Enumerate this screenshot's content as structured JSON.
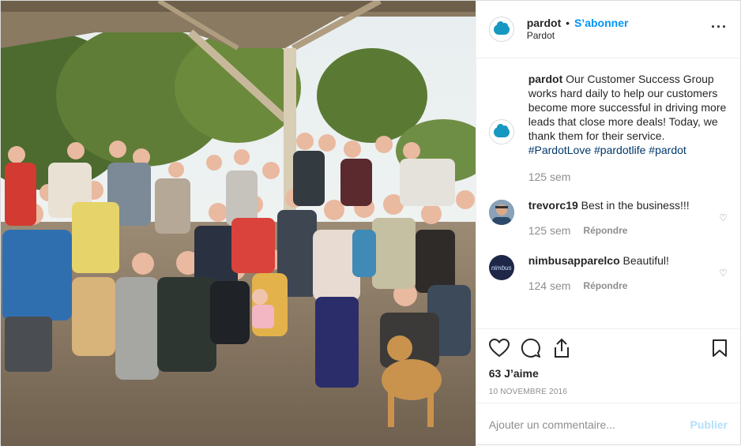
{
  "post": {
    "photo_alt": "",
    "account": {
      "username": "pardot",
      "follow_label": "S’abonner",
      "subtitle": "Pardot"
    },
    "caption": {
      "username": "pardot",
      "text": " Our Customer Success Group works hard daily to help our customers become more successful in driving more leads that close more deals! Today, we thank them for their service. ",
      "hashtags": [
        "#PardotLove",
        "#pardotlife",
        "#pardot"
      ],
      "time": "125 sem"
    },
    "comments": [
      {
        "username": "trevorc19",
        "text": " Best in the business!!!",
        "time": "125 sem",
        "reply_label": "Répondre"
      },
      {
        "username": "nimbusapparelco",
        "text": " Beautiful!",
        "time": "124 sem",
        "reply_label": "Répondre",
        "avatar_text": "nimbus"
      }
    ],
    "likes": "63 J’aime",
    "date": "10 NOVEMBRE 2016",
    "add_comment": {
      "placeholder": "Ajouter un commentaire...",
      "publish_label": "Publier"
    },
    "icons": [
      "more-options-icon",
      "heart-icon",
      "comment-icon",
      "share-icon",
      "bookmark-icon",
      "comment-like-icon"
    ],
    "colors": {
      "follow": "#0095f6",
      "publish_disabled": "#b2dffc",
      "brand_cloud": "#1798c1"
    }
  }
}
